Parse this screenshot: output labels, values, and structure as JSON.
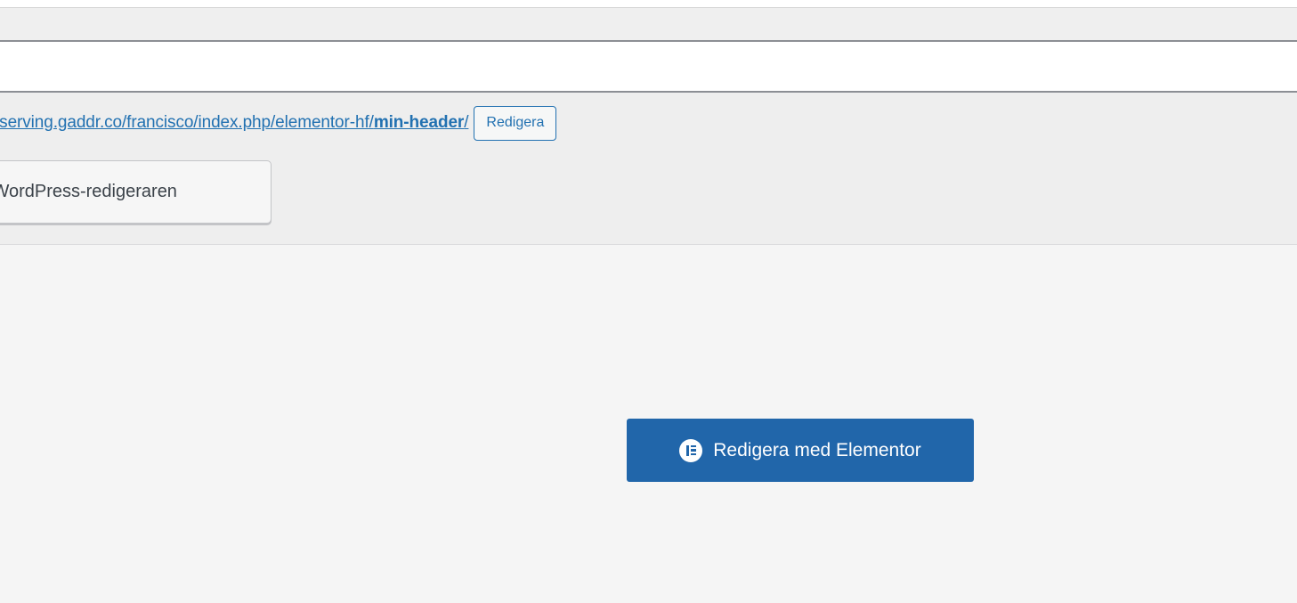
{
  "title_field": {
    "value": "",
    "placeholder": ""
  },
  "permalink": {
    "base_text": "/serving.gaddr.co/francisco/index.php/elementor-hf/",
    "slug": "min-header",
    "trailing": "/",
    "edit_button_label": "Redigera"
  },
  "back_to_wp_editor": {
    "label": "ll WordPress-redigeraren"
  },
  "elementor": {
    "button_label": "Redigera med Elementor",
    "icon": "elementor-icon",
    "brand_color": "#2166aa"
  },
  "colors": {
    "link": "#2271b1",
    "meta_background": "#eeeeee",
    "editor_background": "#f5f5f5"
  }
}
